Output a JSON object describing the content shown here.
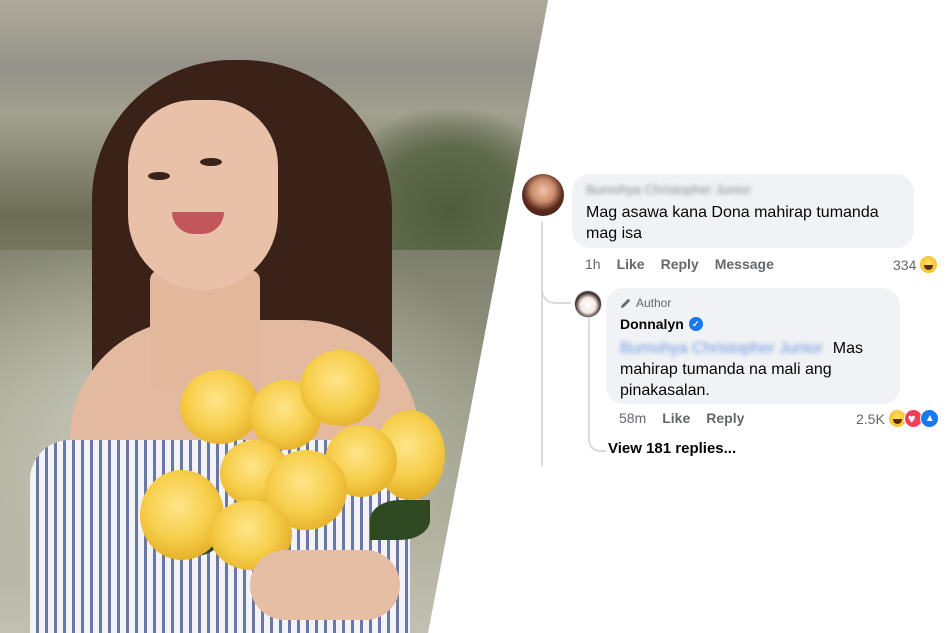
{
  "photo": {
    "alt": "Woman smiling holding yellow roses"
  },
  "comment": {
    "author": "Bumohya Christopher Junior",
    "text": "Mag asawa kana Dona mahirap tumanda mag isa",
    "time": "1h",
    "actions": [
      "Like",
      "Reply",
      "Message"
    ],
    "reaction_count": "334",
    "reaction_icons": [
      "haha-icon"
    ]
  },
  "reply": {
    "badge": "Author",
    "author": "Donnalyn",
    "verified": true,
    "mention": "Bumohya Christopher Junior",
    "text": "Mas mahirap tumanda na mali ang pinakasalan.",
    "time": "58m",
    "actions": [
      "Like",
      "Reply"
    ],
    "reaction_count": "2.5K",
    "reaction_icons": [
      "haha-icon",
      "love-icon",
      "like-icon"
    ]
  },
  "view_replies": "View 181 replies...",
  "colors": {
    "bubble": "#f0f2f5",
    "text": "#050505",
    "muted": "#65676b",
    "verified": "#1877f2",
    "thread_line": "#d8dadf"
  }
}
